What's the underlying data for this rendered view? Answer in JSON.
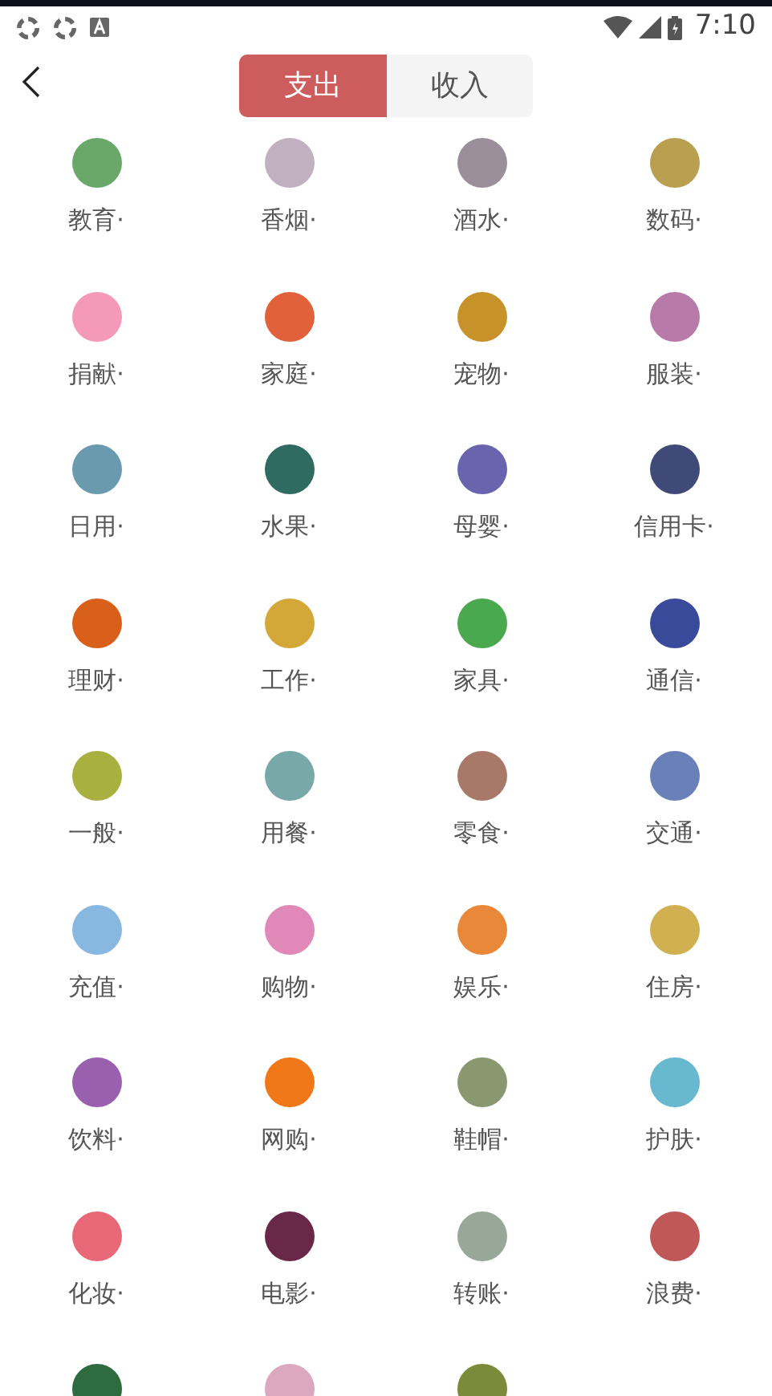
{
  "status_bar": {
    "time": "7:10"
  },
  "tabs": [
    {
      "label": "支出",
      "selected": true
    },
    {
      "label": "收入",
      "selected": false
    }
  ],
  "categories": [
    {
      "label": "教育·",
      "color": "#6aa86a"
    },
    {
      "label": "香烟·",
      "color": "#c0b0c0"
    },
    {
      "label": "酒水·",
      "color": "#9a8e9a"
    },
    {
      "label": "数码·",
      "color": "#b8a050"
    },
    {
      "label": "捐献·",
      "color": "#f49ab8"
    },
    {
      "label": "家庭·",
      "color": "#e0613a"
    },
    {
      "label": "宠物·",
      "color": "#c8922a"
    },
    {
      "label": "服装·",
      "color": "#b87aa8"
    },
    {
      "label": "日用·",
      "color": "#6a9aae"
    },
    {
      "label": "水果·",
      "color": "#2f6b60"
    },
    {
      "label": "母婴·",
      "color": "#6a64ae"
    },
    {
      "label": "信用卡·",
      "color": "#3f4a78"
    },
    {
      "label": "理财·",
      "color": "#d8601a"
    },
    {
      "label": "工作·",
      "color": "#d4a838"
    },
    {
      "label": "家具·",
      "color": "#4aa84e"
    },
    {
      "label": "通信·",
      "color": "#3a4a9a"
    },
    {
      "label": "一般·",
      "color": "#a8b040"
    },
    {
      "label": "用餐·",
      "color": "#78a8a8"
    },
    {
      "label": "零食·",
      "color": "#a87868"
    },
    {
      "label": "交通·",
      "color": "#6a80b8"
    },
    {
      "label": "充值·",
      "color": "#88b8e0"
    },
    {
      "label": "购物·",
      "color": "#e088b8"
    },
    {
      "label": "娱乐·",
      "color": "#e88838"
    },
    {
      "label": "住房·",
      "color": "#d0b050"
    },
    {
      "label": "饮料·",
      "color": "#9a60b0"
    },
    {
      "label": "网购·",
      "color": "#f07818"
    },
    {
      "label": "鞋帽·",
      "color": "#8a9870"
    },
    {
      "label": "护肤·",
      "color": "#68b8d0"
    },
    {
      "label": "化妆·",
      "color": "#e86878"
    },
    {
      "label": "电影·",
      "color": "#6a2848"
    },
    {
      "label": "转账·",
      "color": "#98a898"
    },
    {
      "label": "浪费·",
      "color": "#c05858"
    }
  ],
  "cut_off_categories": [
    {
      "color": "#2e6b3f"
    },
    {
      "color": "#dca8c0"
    },
    {
      "color": "#7c8b3a"
    }
  ]
}
